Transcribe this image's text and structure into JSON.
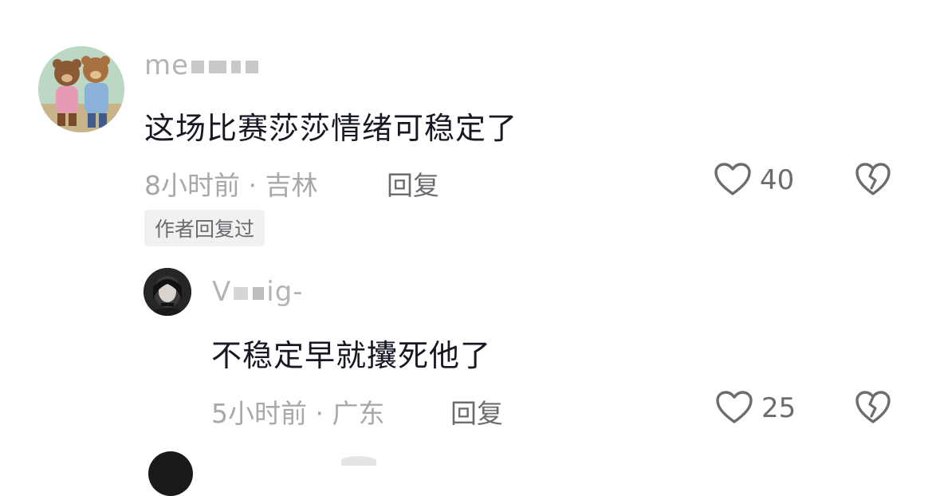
{
  "comments": [
    {
      "username": "me",
      "text": "这场比赛莎莎情绪可稳定了",
      "time": "8小时前",
      "location": "吉林",
      "reply_label": "回复",
      "badge": "作者回复过",
      "likes": "40"
    },
    {
      "username": "V",
      "username_suffix": "ig-",
      "text": "不稳定早就攮死他了",
      "time": "5小时前",
      "location": "广东",
      "reply_label": "回复",
      "likes": "25"
    }
  ],
  "separator": "·",
  "icons": {
    "like": "heart-outline-icon",
    "dislike": "broken-heart-icon"
  },
  "colors": {
    "text_primary": "#161823",
    "text_secondary": "#a8a8ab",
    "text_action": "#6b6b70",
    "badge_bg": "#f1f1f2"
  }
}
